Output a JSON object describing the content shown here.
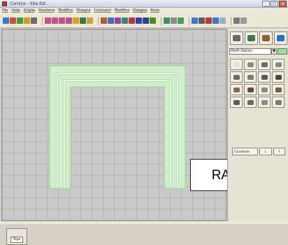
{
  "window": {
    "title": "Cornice - Sita Est",
    "minimize": "_",
    "maximize": "□",
    "close": "x"
  },
  "menu": [
    "File",
    "Vista",
    "Griglia",
    "Posizione",
    "Modifica",
    "Disegna",
    "Costruisci",
    "Modifica",
    "Disegna",
    "Aiuto"
  ],
  "toolbar_groups": [
    [
      "#2e7bd6",
      "#d64a3a",
      "#3a9a3a",
      "#caa12f",
      "#6a6a6a"
    ],
    [
      "#c44f8a",
      "#c44f8a",
      "#c44f8a",
      "#c44f8a",
      "#d9a51f",
      "#3b7b3b",
      "#c8a33a"
    ],
    [
      "#b65a2a",
      "#3c6fc2",
      "#9b3fa7",
      "#2f8b74",
      "#b23b3b",
      "#3b3bb2",
      "#234b8b",
      "#4b8b23"
    ],
    [
      "#3a8f6a",
      "#8a8a8a",
      "#3aa05a"
    ],
    [
      "#3b7bd6",
      "#5d5d5d",
      "#c0392b",
      "#2e7bd6",
      "#8fb0d0"
    ],
    [
      "#7a7a7a",
      "#9a9a9a"
    ]
  ],
  "canvas": {
    "label": "RAHME",
    "frame_colors": {
      "fill": "#cfefc9",
      "stroke": "#ffffff",
      "edge": "#9fcf98"
    },
    "view_button": "Tops"
  },
  "panel": {
    "big_tools": [
      "#6b6b6b",
      "#3d7a3d",
      "#9a5a2a",
      "#2e6cc0"
    ],
    "layer": "Perfil (Serie)",
    "layer_arrow": "▼",
    "swatch_color": "#9fe09a",
    "tool_rows": [
      [
        "#e6e2d4",
        "#8a8a8a",
        "#6a6a6a",
        "#8a8a8a"
      ],
      [
        "#6a6a6a",
        "#7a7a7a",
        "#5a5a5a",
        "#4a4a4a"
      ],
      [
        "#8a6a4a",
        "#6a4a2a",
        "#8a8a8a",
        "#7a5a3a"
      ],
      [
        "#5a5a5a",
        "#6a6a6a",
        "#8a8a8a",
        "#7a7a7a"
      ]
    ],
    "tabs": {
      "coordinates": "Coordinate",
      "t1": "1",
      "t2": "7"
    }
  }
}
